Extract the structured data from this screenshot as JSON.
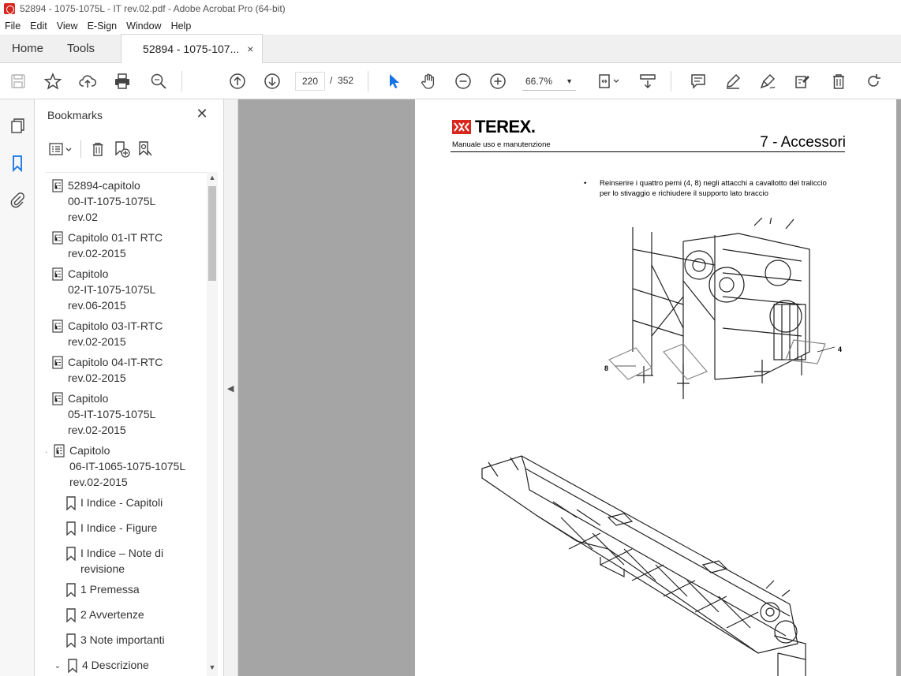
{
  "window": {
    "title": "52894 - 1075-1075L - IT rev.02.pdf - Adobe Acrobat Pro (64-bit)"
  },
  "menu": [
    "File",
    "Edit",
    "View",
    "E-Sign",
    "Window",
    "Help"
  ],
  "tabs": {
    "home": "Home",
    "tools": "Tools",
    "document": "52894 - 1075-107...",
    "close_glyph": "×"
  },
  "toolbar": {
    "current_page": "220",
    "page_separator": "/",
    "total_pages": "352",
    "zoom": "66.7%"
  },
  "bookmarks": {
    "header": "Bookmarks",
    "items": [
      {
        "label": "52894-capitolo\n00-IT-1075-1075L\nrev.02",
        "type": "doc"
      },
      {
        "label": "Capitolo 01-IT RTC\nrev.02-2015",
        "type": "doc"
      },
      {
        "label": "Capitolo\n02-IT-1075-1075L\nrev.06-2015",
        "type": "doc"
      },
      {
        "label": "Capitolo 03-IT-RTC\nrev.02-2015",
        "type": "doc"
      },
      {
        "label": "Capitolo 04-IT-RTC\nrev.02-2015",
        "type": "doc"
      },
      {
        "label": "Capitolo\n05-IT-1075-1075L\nrev.02-2015",
        "type": "doc"
      },
      {
        "label": "Capitolo\n06-IT-1065-1075-1075L\nrev.02-2015",
        "type": "doc",
        "expanded": true
      },
      {
        "label": "I Indice - Capitoli",
        "type": "bookmark"
      },
      {
        "label": "I Indice - Figure",
        "type": "bookmark"
      },
      {
        "label": "I Indice – Note di\nrevisione",
        "type": "bookmark"
      },
      {
        "label": "1 Premessa",
        "type": "bookmark"
      },
      {
        "label": "2 Avvertenze",
        "type": "bookmark"
      },
      {
        "label": "3 Note importanti",
        "type": "bookmark"
      },
      {
        "label": "4 Descrizione",
        "type": "bookmark",
        "expanded": true
      }
    ]
  },
  "document": {
    "logo_text": "TEREX.",
    "subtitle": "Manuale uso e manutenzione",
    "chapter": "7 - Accessori",
    "bullet_marker": "•",
    "bullet_text_1": "Reinserire i quattro perni (4, 8) negli attacchi a cavallotto del traliccio",
    "bullet_text_2": "per lo stivaggio e richiudere il supporto lato braccio",
    "callout_4": "4",
    "callout_8": "8"
  },
  "colors": {
    "accent_blue": "#1473e6",
    "terex_red": "#d7271e",
    "doc_background": "#a5a5a5"
  }
}
